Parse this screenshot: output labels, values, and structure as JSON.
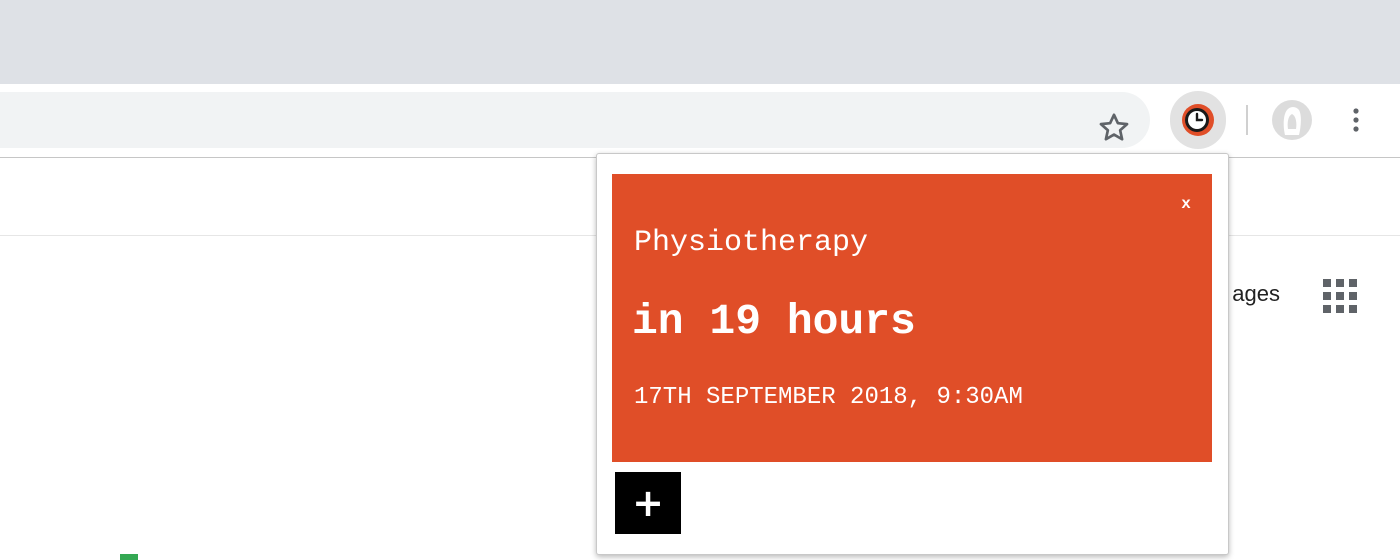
{
  "browser": {
    "icons": {
      "bookmark": "star-icon",
      "extension": "clock-icon",
      "profile": "avatar-icon",
      "menu": "kebab-icon",
      "apps": "apps-grid-icon"
    }
  },
  "page": {
    "images_link": "ages"
  },
  "popup": {
    "card": {
      "close_label": "x",
      "title": "Physiotherapy",
      "countdown": "in 19 hours",
      "datetime": "17TH SEPTEMBER 2018, 9:30AM",
      "color": "#e04e28"
    },
    "add_button_label": "+"
  }
}
